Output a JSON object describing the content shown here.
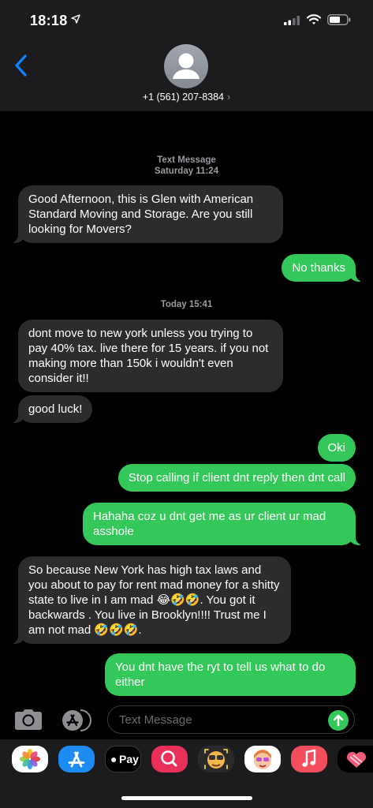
{
  "status_bar": {
    "time": "18:18",
    "icons": [
      "location-arrow-icon",
      "signal-bars-icon",
      "wifi-icon",
      "battery-icon"
    ]
  },
  "header": {
    "contact": "+1 (561) 207-8384",
    "chevron": "›",
    "back_icon": "chevron-left-icon",
    "avatar_icon": "person-silhouette-icon"
  },
  "thread": {
    "ts1": {
      "label": "Text Message",
      "time": "Saturday 11:24"
    },
    "ts2": {
      "time": "Today 15:41"
    },
    "messages": [
      {
        "from": "them",
        "text": "Good Afternoon, this is Glen with American Standard Moving and Storage. Are you still looking for Movers?"
      },
      {
        "from": "me",
        "text": "No  thanks"
      },
      {
        "from": "them",
        "text": "dont move to new york unless you trying to pay 40% tax. live there for 15 years. if you not making more than 150k i wouldn't even consider it!!"
      },
      {
        "from": "them",
        "text": "good luck!"
      },
      {
        "from": "me",
        "text": "Oki"
      },
      {
        "from": "me",
        "text": "Stop calling if client dnt reply then dnt call"
      },
      {
        "from": "me",
        "text": "Hahaha coz u dnt get me as ur client ur mad asshole"
      },
      {
        "from": "them",
        "text": "So because New York has high tax laws and you about to pay for rent mad money for a shitty state to live in I am mad 😂🤣🤣. You got it backwards . You live in Brooklyn!!!! Trust me I am not mad 🤣🤣🤣."
      },
      {
        "from": "me",
        "text": "You dnt have the ryt to tell us what to do either"
      }
    ]
  },
  "composer": {
    "placeholder": "Text Message",
    "camera_icon": "camera-icon",
    "apps_icon": "app-store-icon",
    "send_icon": "send-arrow-icon"
  },
  "app_strip": {
    "apps": [
      {
        "name": "photos-app-icon"
      },
      {
        "name": "app-store-app-icon"
      },
      {
        "name": "apple-pay-app-icon",
        "label": "Pay"
      },
      {
        "name": "images-search-app-icon"
      },
      {
        "name": "animoji-app-icon"
      },
      {
        "name": "memoji-app-icon"
      },
      {
        "name": "music-app-icon"
      },
      {
        "name": "digital-touch-app-icon"
      }
    ]
  },
  "colors": {
    "bubble_out": "#34c759",
    "bubble_in": "#2c2c2e",
    "accent": "#0a84ff",
    "background": "#000000"
  }
}
